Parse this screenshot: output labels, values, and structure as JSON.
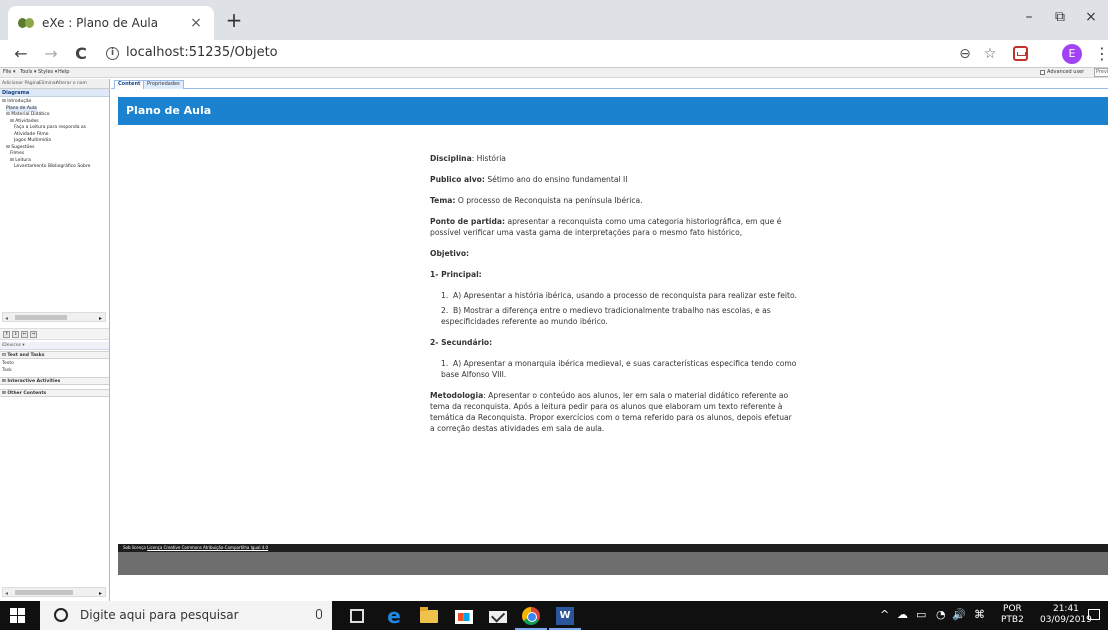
{
  "browser": {
    "tab_title": "eXe : Plano de Aula",
    "tab_close": "×",
    "new_tab": "+",
    "window_controls": {
      "minimize": "–",
      "restore": "⧉",
      "close": "×"
    },
    "nav": {
      "back": "←",
      "forward": "→",
      "reload": "C"
    },
    "info_glyph": "i",
    "url": "localhost:51235/Objeto",
    "zoom_icon": "⊖",
    "star_icon": "☆",
    "profile_initial": "E",
    "menu_icon": "⋮"
  },
  "app_menu": {
    "items": [
      "File ▾",
      "Tools ▾",
      "Styles ▾",
      "Help"
    ],
    "advanced_user": "Advanced user",
    "preview": "Previ"
  },
  "left_panel": {
    "toolbar": [
      "Adicionar Página",
      "Eliminar",
      "Alterar o nom"
    ],
    "outline_title": "Diagrama",
    "tree": [
      {
        "label": "⊟ Introdução",
        "indent": 0
      },
      {
        "label": "Plano de Aula",
        "indent": 1,
        "selected": true
      },
      {
        "label": "⊟ Material Didático",
        "indent": 1
      },
      {
        "label": "⊟ Atividades",
        "indent": 2
      },
      {
        "label": "Faça a Leitura para responda as",
        "indent": 3
      },
      {
        "label": "Atividade Filme",
        "indent": 3
      },
      {
        "label": "Jogos Multimídia",
        "indent": 3
      },
      {
        "label": "⊟ Sugestões",
        "indent": 1
      },
      {
        "label": "Filmes",
        "indent": 2
      },
      {
        "label": "⊟ Leitura",
        "indent": 2
      },
      {
        "label": "Levantamento Bibliográfico Sobre",
        "indent": 3
      }
    ],
    "move_buttons": [
      "⇑",
      "⇓",
      "⇐",
      "⇒"
    ],
    "idevices_label": "iDevices ▾",
    "categories": [
      {
        "title": "⊟ Text and Tasks",
        "items": [
          "Texto",
          "Task"
        ]
      },
      {
        "title": "⊞ Interactive Activities",
        "items": []
      },
      {
        "title": "⊞ Other Contents",
        "items": []
      }
    ],
    "scroll": {
      "left": "◂",
      "right": "▸"
    }
  },
  "content_tabs": [
    {
      "label": "Content",
      "active": true
    },
    {
      "label": "Propriedades",
      "active": false
    }
  ],
  "page": {
    "title": "Plano de Aula",
    "disciplina": {
      "label": "Disciplina",
      "value": ": História"
    },
    "publico": {
      "label": "Publico alvo:",
      "value": " Sétimo ano do ensino fundamental II"
    },
    "tema": {
      "label": "Tema:",
      "value": " O processo de Reconquista na península Ibérica."
    },
    "ponto": {
      "label": "Ponto de partida:",
      "value": " apresentar a reconquista como uma categoria historiográfica, em que é possível verificar uma vasta gama de interpretações para o mesmo fato histórico,"
    },
    "objetivo": "Objetivo:",
    "principal": {
      "title": "1- Principal:",
      "items": [
        {
          "num": "1.",
          "text": "A) Apresentar a história ibérica, usando a processo de reconquista para realizar este feito."
        },
        {
          "num": "2.",
          "text": "B) Mostrar a diferença entre o medievo tradicionalmente trabalho nas escolas, e as especificidades referente ao mundo ibérico."
        }
      ]
    },
    "secundario": {
      "title": "2- Secundário:",
      "items": [
        {
          "num": "1.",
          "text": "A) Apresentar a monarquia ibérica medieval, e suas características especifica tendo como base Alfonso VIII."
        }
      ]
    },
    "metodologia": {
      "label": "Metodologia",
      "value": ": Apresentar o conteúdo aos alunos, ler em sala o material didático referente ao tema da reconquista. Após a leitura pedir para os alunos que elaboram um texto referente à temática da Reconquista. Propor exercícios com o tema referido para os alunos, depois efetuar a correção destas atividades em sala de aula."
    },
    "footer_prefix": "Sob licença ",
    "footer_link": "Licença Creative Commons Atribuição-Compartilha Igual 4.0"
  },
  "taskbar": {
    "search_placeholder": "Digite aqui para pesquisar",
    "word_label": "W",
    "edge_label": "e",
    "tray_icons": [
      "^",
      "☁",
      "▭",
      "◔",
      "🔊",
      "⌘"
    ],
    "lang_line1": "POR",
    "lang_line2": "PTB2",
    "time": "21:41",
    "date": "03/09/2019"
  }
}
